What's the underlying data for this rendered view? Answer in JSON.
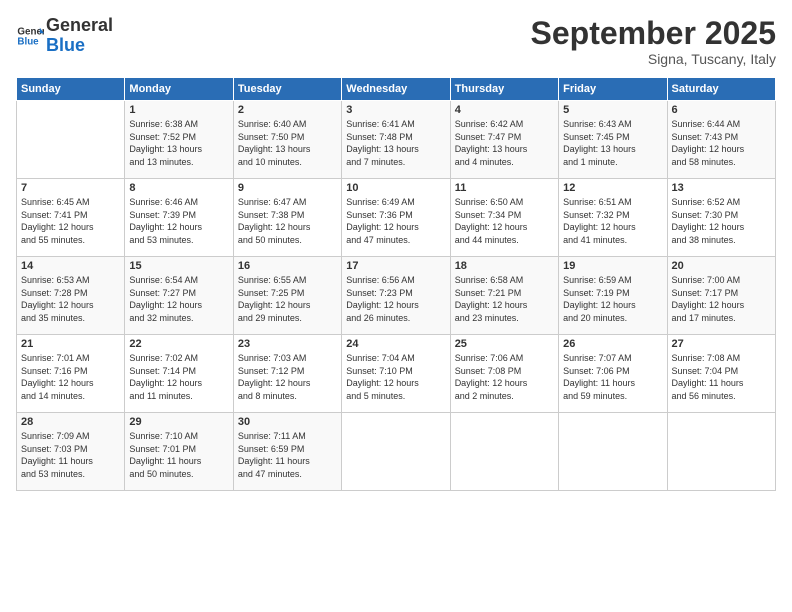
{
  "header": {
    "logo_general": "General",
    "logo_blue": "Blue",
    "month_title": "September 2025",
    "subtitle": "Signa, Tuscany, Italy"
  },
  "columns": [
    "Sunday",
    "Monday",
    "Tuesday",
    "Wednesday",
    "Thursday",
    "Friday",
    "Saturday"
  ],
  "weeks": [
    [
      {
        "day": "",
        "info": ""
      },
      {
        "day": "1",
        "info": "Sunrise: 6:38 AM\nSunset: 7:52 PM\nDaylight: 13 hours\nand 13 minutes."
      },
      {
        "day": "2",
        "info": "Sunrise: 6:40 AM\nSunset: 7:50 PM\nDaylight: 13 hours\nand 10 minutes."
      },
      {
        "day": "3",
        "info": "Sunrise: 6:41 AM\nSunset: 7:48 PM\nDaylight: 13 hours\nand 7 minutes."
      },
      {
        "day": "4",
        "info": "Sunrise: 6:42 AM\nSunset: 7:47 PM\nDaylight: 13 hours\nand 4 minutes."
      },
      {
        "day": "5",
        "info": "Sunrise: 6:43 AM\nSunset: 7:45 PM\nDaylight: 13 hours\nand 1 minute."
      },
      {
        "day": "6",
        "info": "Sunrise: 6:44 AM\nSunset: 7:43 PM\nDaylight: 12 hours\nand 58 minutes."
      }
    ],
    [
      {
        "day": "7",
        "info": "Sunrise: 6:45 AM\nSunset: 7:41 PM\nDaylight: 12 hours\nand 55 minutes."
      },
      {
        "day": "8",
        "info": "Sunrise: 6:46 AM\nSunset: 7:39 PM\nDaylight: 12 hours\nand 53 minutes."
      },
      {
        "day": "9",
        "info": "Sunrise: 6:47 AM\nSunset: 7:38 PM\nDaylight: 12 hours\nand 50 minutes."
      },
      {
        "day": "10",
        "info": "Sunrise: 6:49 AM\nSunset: 7:36 PM\nDaylight: 12 hours\nand 47 minutes."
      },
      {
        "day": "11",
        "info": "Sunrise: 6:50 AM\nSunset: 7:34 PM\nDaylight: 12 hours\nand 44 minutes."
      },
      {
        "day": "12",
        "info": "Sunrise: 6:51 AM\nSunset: 7:32 PM\nDaylight: 12 hours\nand 41 minutes."
      },
      {
        "day": "13",
        "info": "Sunrise: 6:52 AM\nSunset: 7:30 PM\nDaylight: 12 hours\nand 38 minutes."
      }
    ],
    [
      {
        "day": "14",
        "info": "Sunrise: 6:53 AM\nSunset: 7:28 PM\nDaylight: 12 hours\nand 35 minutes."
      },
      {
        "day": "15",
        "info": "Sunrise: 6:54 AM\nSunset: 7:27 PM\nDaylight: 12 hours\nand 32 minutes."
      },
      {
        "day": "16",
        "info": "Sunrise: 6:55 AM\nSunset: 7:25 PM\nDaylight: 12 hours\nand 29 minutes."
      },
      {
        "day": "17",
        "info": "Sunrise: 6:56 AM\nSunset: 7:23 PM\nDaylight: 12 hours\nand 26 minutes."
      },
      {
        "day": "18",
        "info": "Sunrise: 6:58 AM\nSunset: 7:21 PM\nDaylight: 12 hours\nand 23 minutes."
      },
      {
        "day": "19",
        "info": "Sunrise: 6:59 AM\nSunset: 7:19 PM\nDaylight: 12 hours\nand 20 minutes."
      },
      {
        "day": "20",
        "info": "Sunrise: 7:00 AM\nSunset: 7:17 PM\nDaylight: 12 hours\nand 17 minutes."
      }
    ],
    [
      {
        "day": "21",
        "info": "Sunrise: 7:01 AM\nSunset: 7:16 PM\nDaylight: 12 hours\nand 14 minutes."
      },
      {
        "day": "22",
        "info": "Sunrise: 7:02 AM\nSunset: 7:14 PM\nDaylight: 12 hours\nand 11 minutes."
      },
      {
        "day": "23",
        "info": "Sunrise: 7:03 AM\nSunset: 7:12 PM\nDaylight: 12 hours\nand 8 minutes."
      },
      {
        "day": "24",
        "info": "Sunrise: 7:04 AM\nSunset: 7:10 PM\nDaylight: 12 hours\nand 5 minutes."
      },
      {
        "day": "25",
        "info": "Sunrise: 7:06 AM\nSunset: 7:08 PM\nDaylight: 12 hours\nand 2 minutes."
      },
      {
        "day": "26",
        "info": "Sunrise: 7:07 AM\nSunset: 7:06 PM\nDaylight: 11 hours\nand 59 minutes."
      },
      {
        "day": "27",
        "info": "Sunrise: 7:08 AM\nSunset: 7:04 PM\nDaylight: 11 hours\nand 56 minutes."
      }
    ],
    [
      {
        "day": "28",
        "info": "Sunrise: 7:09 AM\nSunset: 7:03 PM\nDaylight: 11 hours\nand 53 minutes."
      },
      {
        "day": "29",
        "info": "Sunrise: 7:10 AM\nSunset: 7:01 PM\nDaylight: 11 hours\nand 50 minutes."
      },
      {
        "day": "30",
        "info": "Sunrise: 7:11 AM\nSunset: 6:59 PM\nDaylight: 11 hours\nand 47 minutes."
      },
      {
        "day": "",
        "info": ""
      },
      {
        "day": "",
        "info": ""
      },
      {
        "day": "",
        "info": ""
      },
      {
        "day": "",
        "info": ""
      }
    ]
  ]
}
